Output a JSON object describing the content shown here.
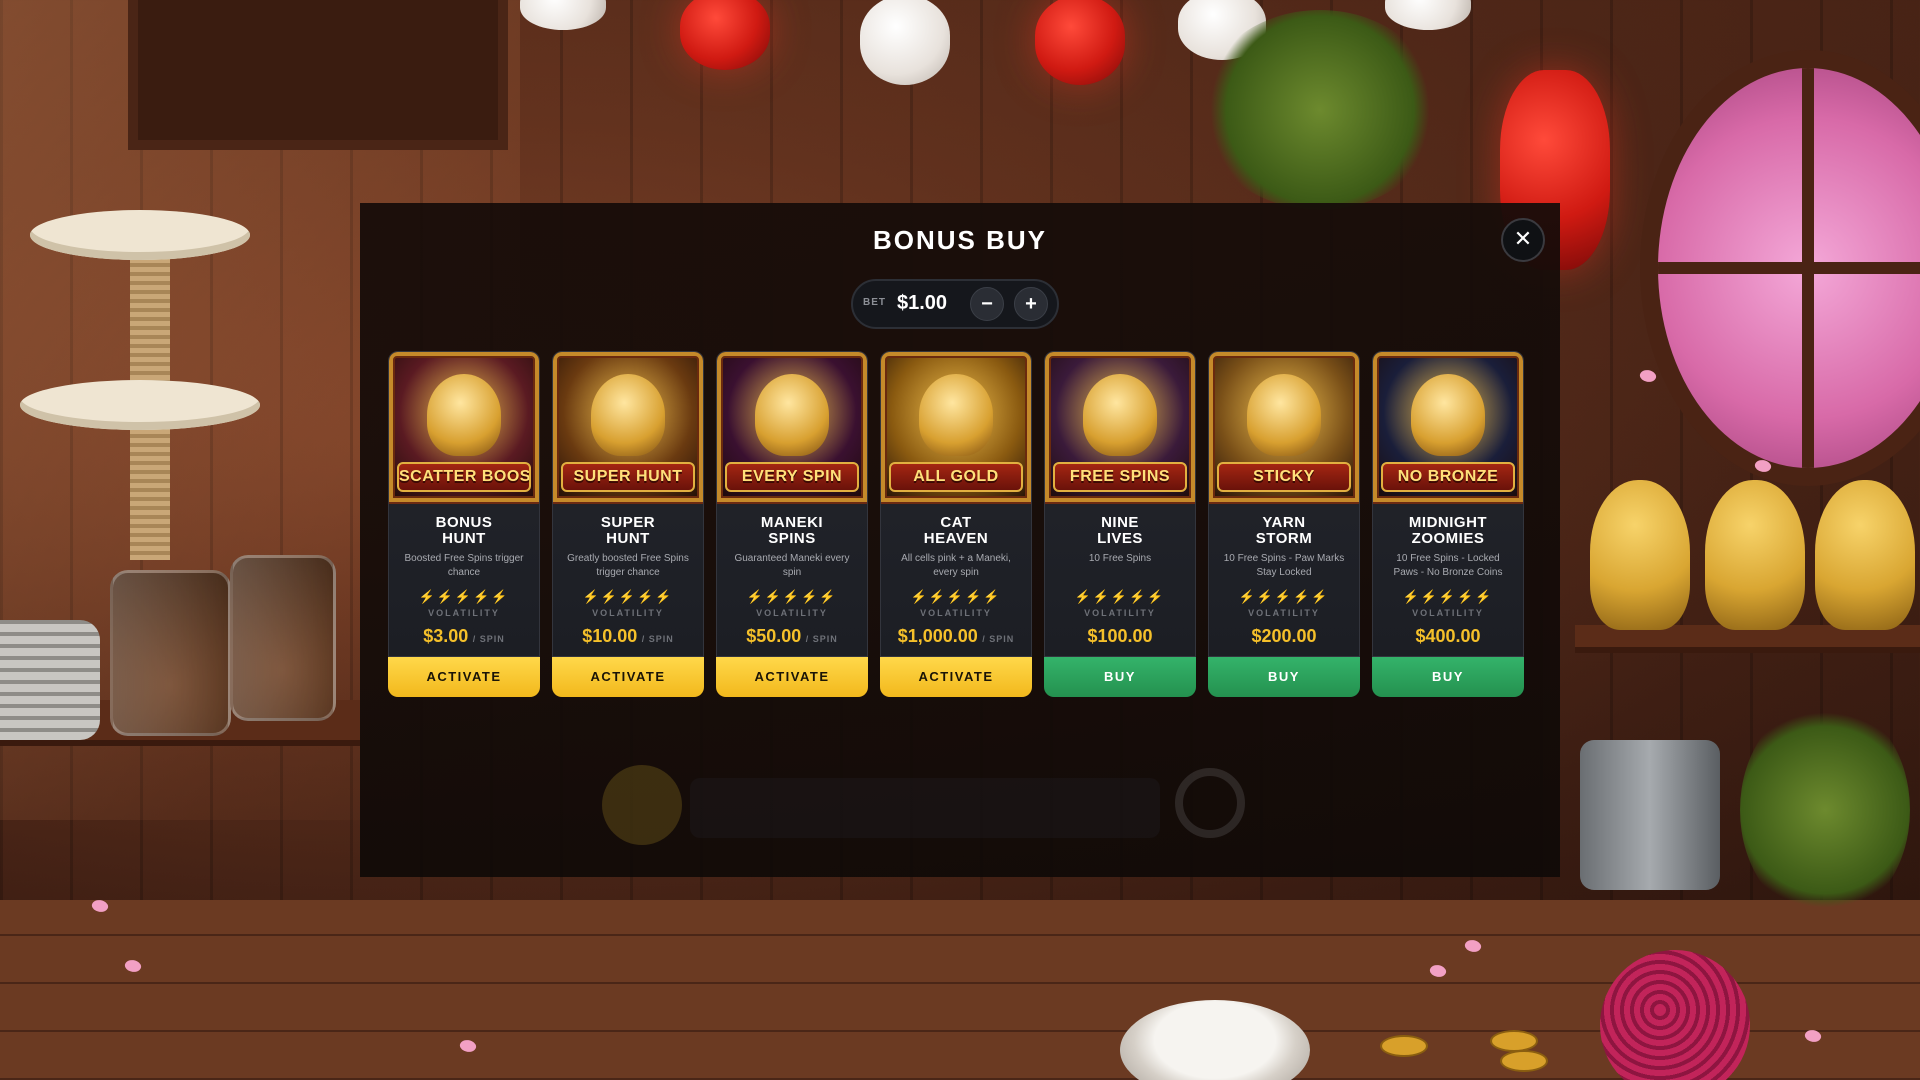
{
  "modal": {
    "title": "BONUS BUY",
    "close_label": "✕"
  },
  "bet": {
    "label": "BET",
    "value": "$1.00",
    "minus_label": "−",
    "plus_label": "+"
  },
  "volatility_label": "VOLATILITY",
  "per_spin_label": "/ SPIN",
  "cards": [
    {
      "banner": "SCATTER BOOST",
      "name_line1": "BONUS",
      "name_line2": "HUNT",
      "description": "Boosted Free Spins trigger chance",
      "volatility_stars": 5,
      "price": "$3.00",
      "per_spin": true,
      "button_label": "ACTIVATE",
      "button_style": "yellow",
      "art_color": "#5a1a22"
    },
    {
      "banner": "SUPER HUNT",
      "name_line1": "SUPER",
      "name_line2": "HUNT",
      "description": "Greatly boosted Free Spins trigger chance",
      "volatility_stars": 5,
      "price": "$10.00",
      "per_spin": true,
      "button_label": "ACTIVATE",
      "button_style": "yellow",
      "art_color": "#6a3a10"
    },
    {
      "banner": "EVERY SPIN",
      "name_line1": "MANEKI",
      "name_line2": "SPINS",
      "description": "Guaranteed Maneki every spin",
      "volatility_stars": 4,
      "price": "$50.00",
      "per_spin": true,
      "button_label": "ACTIVATE",
      "button_style": "yellow",
      "art_color": "#3a1030"
    },
    {
      "banner": "ALL GOLD",
      "name_line1": "CAT",
      "name_line2": "HEAVEN",
      "description": "All cells pink + a Maneki, every spin",
      "volatility_stars": 1,
      "price": "$1,000.00",
      "per_spin": true,
      "button_label": "ACTIVATE",
      "button_style": "yellow",
      "art_color": "#8a5a10"
    },
    {
      "banner": "FREE SPINS",
      "name_line1": "NINE",
      "name_line2": "LIVES",
      "description": "10 Free Spins",
      "volatility_stars": 3,
      "price": "$100.00",
      "per_spin": false,
      "button_label": "BUY",
      "button_style": "green",
      "art_color": "#3a1a3a"
    },
    {
      "banner": "STICKY",
      "name_line1": "YARN",
      "name_line2": "STORM",
      "description": "10 Free Spins - Paw Marks Stay Locked",
      "volatility_stars": 3,
      "price": "$200.00",
      "per_spin": false,
      "button_label": "BUY",
      "button_style": "green",
      "art_color": "#7a5018"
    },
    {
      "banner": "NO BRONZE",
      "name_line1": "MIDNIGHT",
      "name_line2": "ZOOMIES",
      "description": "10 Free Spins - Locked Paws - No Bronze Coins",
      "volatility_stars": 2,
      "price": "$400.00",
      "per_spin": false,
      "button_label": "BUY",
      "button_style": "green",
      "art_color": "#1a1e3a"
    }
  ],
  "colors": {
    "accent_gold": "#f5c02a",
    "activate_button": "#f2b81c",
    "buy_button": "#24914f",
    "modal_background": "#160c09"
  }
}
